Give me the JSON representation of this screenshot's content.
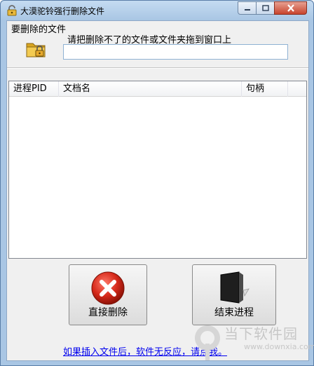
{
  "window": {
    "title": "大漠驼铃强行删除文件"
  },
  "icons": {
    "app": "lock-icon",
    "folder": "locked-folder-icon",
    "delete": "red-x-icon",
    "kill": "black-panel-icon",
    "minimize": "minimize-icon",
    "maximize": "maximize-icon",
    "close": "close-icon"
  },
  "file_group": {
    "label": "要删除的文件",
    "hint": "请把删除不了的文件或文件夹拖到窗口上",
    "input_value": ""
  },
  "process_list": {
    "columns": [
      "进程PID",
      "文档名",
      "句柄"
    ],
    "rows": []
  },
  "buttons": {
    "delete_label": "直接删除",
    "kill_label": "结束进程"
  },
  "help_link": "如果插入文件后，软件无反应，请点我。",
  "watermark": {
    "text": "当下软件园",
    "url": "www.downxia.com"
  },
  "colors": {
    "frame": "#a9c6e4",
    "client_bg": "#f0f0f0",
    "close_red": "#c7442d",
    "link_blue": "#0000ee"
  }
}
